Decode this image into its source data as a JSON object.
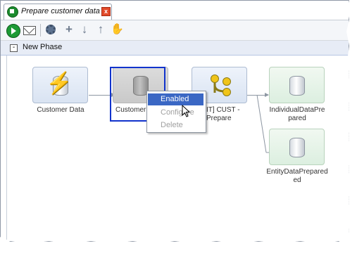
{
  "tab": {
    "title": "Prepare customer data",
    "close_glyph": "x"
  },
  "toolbar": {
    "icons": [
      "run-icon",
      "mail-icon",
      "gear-icon",
      "add-icon",
      "move-down-icon",
      "move-up-icon",
      "hand-icon"
    ]
  },
  "phase": {
    "title": "New Phase",
    "toggle": "-"
  },
  "nodes": [
    {
      "label": "Customer Data",
      "icon": "lightning-database-icon"
    },
    {
      "label": "Customer",
      "icon": "database-icon"
    },
    {
      "label_line1": "IT] CUST -",
      "label_line2": "Prepare",
      "icon": "branch-icon"
    },
    {
      "label_line1": "IndividualDataPre",
      "label_line2": "pared",
      "icon": "database-icon"
    },
    {
      "label_line1": "EntityDataPrepared",
      "label_line2": "ed",
      "icon": "database-icon"
    }
  ],
  "context_menu": {
    "items": [
      {
        "label": "Enabled",
        "state": "highlighted"
      },
      {
        "label": "Configure",
        "state": "disabled"
      },
      {
        "label": "Delete",
        "state": "disabled"
      }
    ]
  },
  "colors": {
    "accent": "#3a67c4",
    "selection": "#1133cc",
    "phase_bar": "#e7ecf6"
  }
}
